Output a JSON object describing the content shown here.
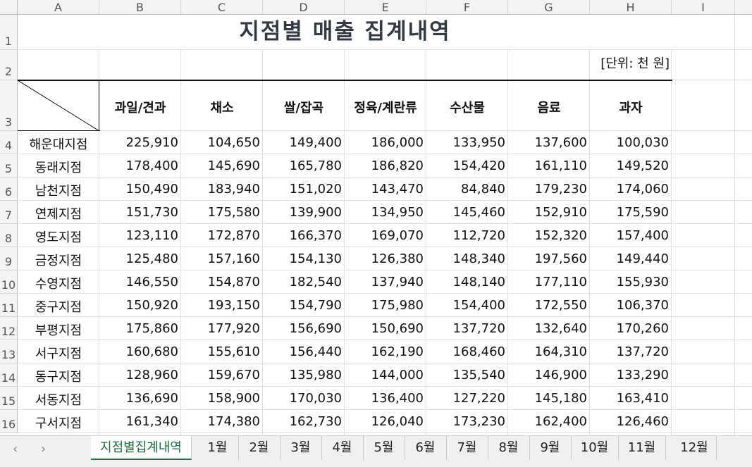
{
  "columns": [
    "A",
    "B",
    "C",
    "D",
    "E",
    "F",
    "G",
    "H",
    "I"
  ],
  "rows": [
    "1",
    "2",
    "3",
    "4",
    "5",
    "6",
    "7",
    "8",
    "9",
    "10",
    "11",
    "12",
    "13",
    "14",
    "15",
    "16"
  ],
  "sheet": {
    "title": "지점별 매출 집계내역",
    "unit": "[단위: 천 원]",
    "headers": [
      "과일/견과",
      "채소",
      "쌀/잡곡",
      "정육/계란류",
      "수산물",
      "음료",
      "과자"
    ],
    "data": [
      {
        "name": "해운대지점",
        "values": [
          "225,910",
          "104,650",
          "149,400",
          "186,000",
          "133,950",
          "137,600",
          "100,030"
        ]
      },
      {
        "name": "동래지점",
        "values": [
          "178,400",
          "145,690",
          "165,780",
          "186,820",
          "154,420",
          "161,110",
          "149,520"
        ]
      },
      {
        "name": "남천지점",
        "values": [
          "150,490",
          "183,940",
          "151,020",
          "143,470",
          "84,840",
          "179,230",
          "174,060"
        ]
      },
      {
        "name": "연제지점",
        "values": [
          "151,730",
          "175,580",
          "139,900",
          "134,950",
          "145,460",
          "152,910",
          "175,590"
        ]
      },
      {
        "name": "영도지점",
        "values": [
          "123,110",
          "172,870",
          "166,370",
          "169,070",
          "112,720",
          "152,320",
          "157,400"
        ]
      },
      {
        "name": "금정지점",
        "values": [
          "125,480",
          "157,160",
          "154,130",
          "126,380",
          "148,340",
          "197,560",
          "149,440"
        ]
      },
      {
        "name": "수영지점",
        "values": [
          "146,550",
          "154,870",
          "182,540",
          "137,940",
          "148,140",
          "177,110",
          "155,930"
        ]
      },
      {
        "name": "중구지점",
        "values": [
          "150,920",
          "193,150",
          "154,790",
          "175,980",
          "154,400",
          "172,550",
          "106,370"
        ]
      },
      {
        "name": "부평지점",
        "values": [
          "175,860",
          "177,920",
          "156,690",
          "150,690",
          "137,720",
          "132,640",
          "170,260"
        ]
      },
      {
        "name": "서구지점",
        "values": [
          "160,680",
          "155,610",
          "156,440",
          "162,190",
          "168,460",
          "164,310",
          "137,720"
        ]
      },
      {
        "name": "동구지점",
        "values": [
          "128,960",
          "159,670",
          "135,980",
          "144,000",
          "135,540",
          "146,900",
          "133,290"
        ]
      },
      {
        "name": "서동지점",
        "values": [
          "136,690",
          "158,900",
          "170,030",
          "136,400",
          "127,220",
          "145,180",
          "163,410"
        ]
      },
      {
        "name": "구서지점",
        "values": [
          "161,340",
          "174,380",
          "162,730",
          "126,040",
          "173,230",
          "162,400",
          "126,460"
        ]
      }
    ]
  },
  "tabs": {
    "prev_icon": "chevron-left-icon",
    "next_icon": "chevron-right-icon",
    "prev_glyph": "‹",
    "next_glyph": "›",
    "items": [
      "지점별집계내역",
      "1월",
      "2월",
      "3월",
      "4월",
      "5월",
      "6월",
      "7월",
      "8월",
      "9월",
      "10월",
      "11월",
      "12월"
    ],
    "active": 0
  },
  "colors": {
    "active_tab": "#217346",
    "title": "#333a44"
  }
}
